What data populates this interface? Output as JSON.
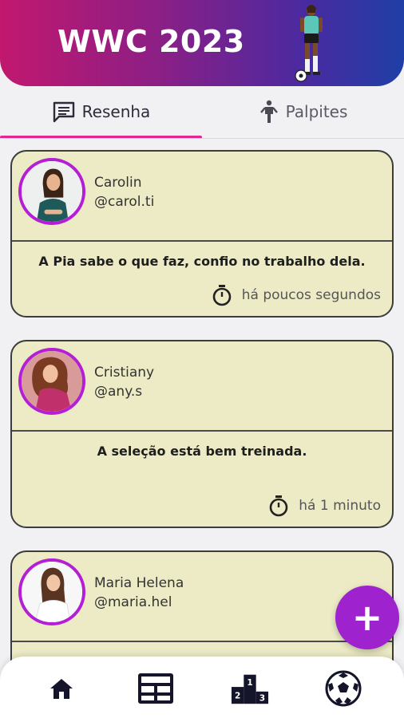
{
  "header": {
    "title": "WWC 2023"
  },
  "tabs": [
    {
      "label": "Resenha",
      "icon": "chat-icon",
      "selected": true
    },
    {
      "label": "Palpites",
      "icon": "player-icon",
      "selected": false
    }
  ],
  "posts": [
    {
      "name": "Carolin",
      "handle": "@carol.ti",
      "message": "A Pia sabe o que faz, confio no trabalho dela.",
      "time": "há poucos segundos"
    },
    {
      "name": "Cristiany",
      "handle": "@any.s",
      "message": "A seleção está bem treinada.",
      "time": "há 1 minuto"
    },
    {
      "name": "Maria Helena",
      "handle": "@maria.hel",
      "message": "",
      "time": ""
    }
  ],
  "fab": {
    "label": "+"
  },
  "bottom_nav": [
    {
      "icon": "home-icon"
    },
    {
      "icon": "grid-icon"
    },
    {
      "icon": "podium-icon"
    },
    {
      "icon": "soccer-ball-icon"
    }
  ],
  "colors": {
    "accent": "#e0288f",
    "fab": "#9f22cf",
    "card": "#ecebc5",
    "avatar_ring": "#b41fd6"
  }
}
